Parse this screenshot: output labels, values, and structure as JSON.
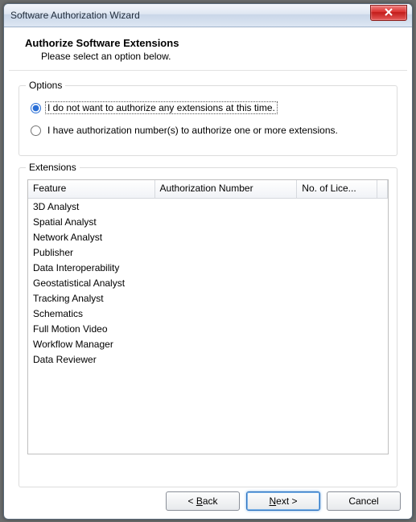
{
  "window": {
    "title": "Software Authorization Wizard"
  },
  "header": {
    "title": "Authorize Software Extensions",
    "subtitle": "Please select an option below."
  },
  "options": {
    "legend": "Options",
    "opt1_label": "I do not want to authorize any extensions at this time.",
    "opt2_label": "I have authorization number(s) to authorize one or more extensions.",
    "selected": 1
  },
  "extensions": {
    "legend": "Extensions",
    "columns": {
      "feature": "Feature",
      "auth": "Authorization Number",
      "lic": "No. of Lice..."
    },
    "rows": [
      {
        "feature": "3D Analyst",
        "auth": "",
        "lic": ""
      },
      {
        "feature": "Spatial Analyst",
        "auth": "",
        "lic": ""
      },
      {
        "feature": "Network Analyst",
        "auth": "",
        "lic": ""
      },
      {
        "feature": "Publisher",
        "auth": "",
        "lic": ""
      },
      {
        "feature": "Data Interoperability",
        "auth": "",
        "lic": ""
      },
      {
        "feature": "Geostatistical Analyst",
        "auth": "",
        "lic": ""
      },
      {
        "feature": "Tracking Analyst",
        "auth": "",
        "lic": ""
      },
      {
        "feature": "Schematics",
        "auth": "",
        "lic": ""
      },
      {
        "feature": "Full Motion Video",
        "auth": "",
        "lic": ""
      },
      {
        "feature": "Workflow Manager",
        "auth": "",
        "lic": ""
      },
      {
        "feature": "Data Reviewer",
        "auth": "",
        "lic": ""
      }
    ]
  },
  "buttons": {
    "back_prefix": "< ",
    "back_u": "B",
    "back_rest": "ack",
    "next_u": "N",
    "next_rest": "ext >",
    "cancel": "Cancel"
  }
}
